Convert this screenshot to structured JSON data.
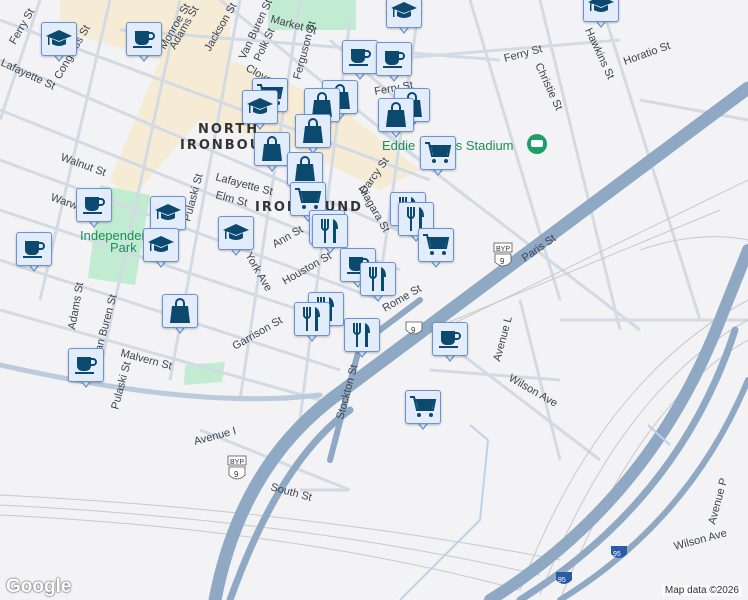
{
  "streets": [
    "Market St",
    "Ferry St",
    "Ferry St",
    "Ferry St",
    "Monroe St",
    "Adams St",
    "Jackson St",
    "Van Buren St",
    "Polk St",
    "Clover St",
    "Ferguson St",
    "Congress St",
    "Lafayette St",
    "Lafayette St",
    "Walnut St",
    "Elm St",
    "Pulaski St",
    "Warwick St",
    "York Ave",
    "Ann St",
    "Houston St",
    "Garrison St",
    "Malvern St",
    "Adams St",
    "Van Buren St",
    "Pulaski St",
    "Rome St",
    "Niagara St",
    "Darcy St",
    "Christie St",
    "Hawkins St",
    "Horatio St",
    "Paris St",
    "Stockton St",
    "South St",
    "Avenue I",
    "Avenue L",
    "Wilson Ave",
    "Wilson Ave",
    "Avenue P"
  ],
  "neighborhood": {
    "line1": "NORTH",
    "line2": "IRONBOUND",
    "line3": "IRONBOUND"
  },
  "park": {
    "line1": "Independence",
    "line2": "Park"
  },
  "poi": {
    "stadium": "Eddie Moraes Stadium"
  },
  "shields": {
    "byp_label": "BYP",
    "route9": "9",
    "i95": "95"
  },
  "markers": [
    "education",
    "coffee",
    "education",
    "education",
    "coffee",
    "coffee",
    "shopping",
    "shopping",
    "grocery",
    "education",
    "shopping",
    "shopping",
    "shopping",
    "shopping",
    "shopping",
    "grocery",
    "grocery",
    "restaurant",
    "restaurant",
    "restaurant",
    "restaurant",
    "grocery",
    "coffee",
    "restaurant",
    "restaurant",
    "restaurant",
    "restaurant",
    "coffee",
    "grocery",
    "coffee",
    "education",
    "education",
    "education",
    "coffee",
    "shopping",
    "coffee"
  ],
  "footer": {
    "logo": "Google",
    "attribution": "Map data ©2026"
  },
  "colors": {
    "marker_bg": "#e3ecfb",
    "marker_border": "#6a93d6",
    "icon": "#0b4a6e",
    "highway": "#8fa9c4",
    "park": "#c2ecd1"
  }
}
